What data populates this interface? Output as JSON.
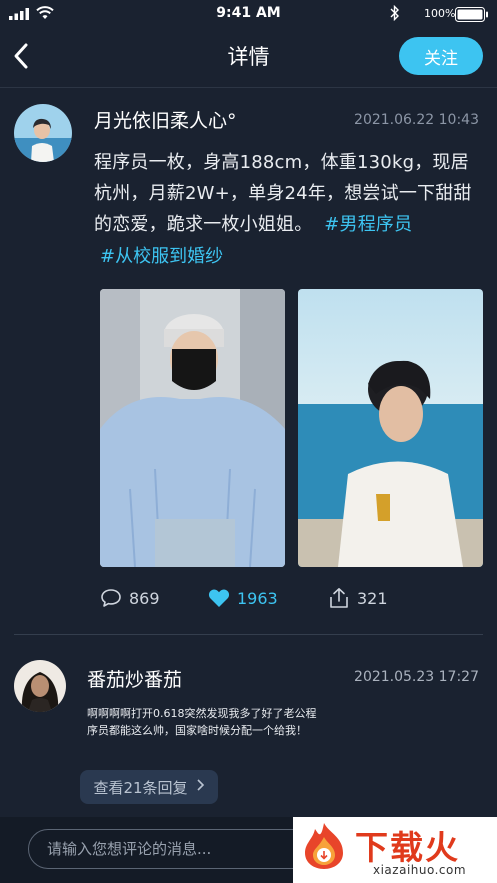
{
  "status_bar": {
    "time": "9:41 AM",
    "battery": "100%"
  },
  "nav": {
    "title": "详情",
    "follow_label": "关注"
  },
  "post": {
    "author": "月光依旧柔人心°",
    "time": "2021.06.22 10:43",
    "text": "程序员一枚，身高188cm，体重130kg，现居杭州，月薪2W+，单身24年，想尝试一下甜甜的恋爱，跪求一枚小姐姐。",
    "hashtags": [
      "#男程序员",
      "#从校服到婚纱"
    ],
    "comments_count": "869",
    "likes_count": "1963",
    "shares_count": "321"
  },
  "comment": {
    "author": "番茄炒番茄",
    "time": "2021.05.23 17:27",
    "text": "啊啊啊啊打开0.618突然发现我多了好了老公程序员都能这么帅，国家啥时候分配一个给我！",
    "replies_label": "查看21条回复"
  },
  "input": {
    "placeholder": "请输入您想评论的消息..."
  },
  "watermark": {
    "brand": "下载火",
    "url": "xiazaihuo.com"
  },
  "colors": {
    "accent": "#3dc4f1",
    "background": "#1a2230",
    "watermark_red": "#e03a1c"
  },
  "icons": [
    "back-icon",
    "comment-icon",
    "heart-icon",
    "share-icon",
    "chevron-right-icon"
  ]
}
